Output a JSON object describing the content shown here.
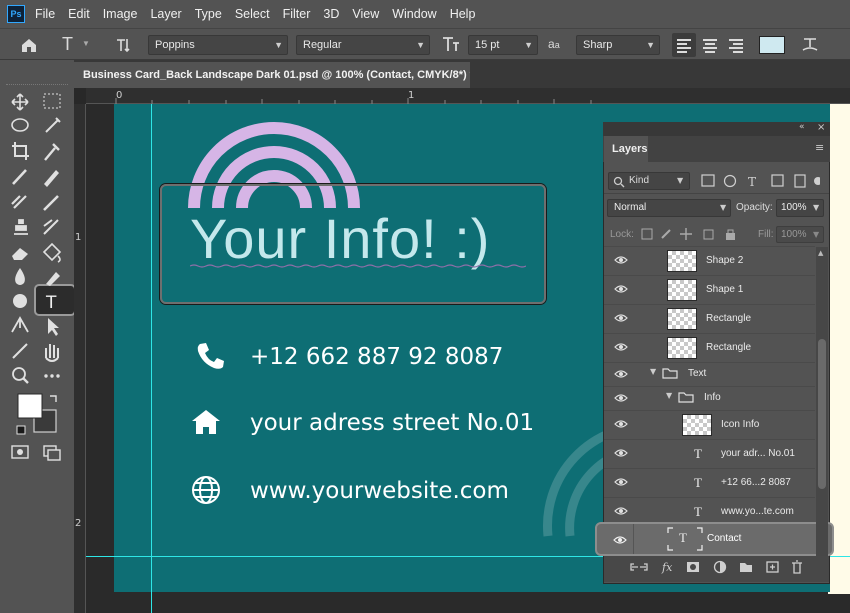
{
  "app": {
    "logo": "Ps"
  },
  "menu": [
    "File",
    "Edit",
    "Image",
    "Layer",
    "Type",
    "Select",
    "Filter",
    "3D",
    "View",
    "Window",
    "Help"
  ],
  "options": {
    "font_family": "Poppins",
    "font_style": "Regular",
    "font_size": "15 pt",
    "antialias_label": "a",
    "antialias": "Sharp",
    "text_color": "#cfe9f0"
  },
  "document": {
    "tab_title": "Business Card_Back Landscape Dark 01.psd @ 100% (Contact, CMYK/8*) *",
    "close": "×"
  },
  "rulers": {
    "top": [
      "0",
      "1"
    ],
    "left": [
      "1",
      "2"
    ]
  },
  "card": {
    "background": "#0e6e74",
    "title": "Your Info! :)",
    "phone": "+12 662 887 92 8087",
    "address": "your adress street No.01",
    "website": "www.yourwebsite.com",
    "arc_color": "#d6b5e6"
  },
  "layers": {
    "tab": "Layers",
    "filter_kind": "Kind",
    "blend_mode": "Normal",
    "opacity_label": "Opacity:",
    "opacity": "100%",
    "lock_label": "Lock:",
    "fill_label": "Fill:",
    "fill": "100%",
    "items": [
      {
        "name": "Shape 2",
        "kind": "shape"
      },
      {
        "name": "Shape 1",
        "kind": "shape"
      },
      {
        "name": "Rectangle",
        "kind": "shape"
      },
      {
        "name": "Rectangle",
        "kind": "shape"
      },
      {
        "name": "Text",
        "kind": "group"
      },
      {
        "name": "Info",
        "kind": "group"
      },
      {
        "name": "Icon Info",
        "kind": "smart"
      },
      {
        "name": "your adr... No.01",
        "kind": "text"
      },
      {
        "name": "+12 66...2 8087",
        "kind": "text"
      },
      {
        "name": "www.yo...te.com",
        "kind": "text"
      },
      {
        "name": "Contact",
        "kind": "text",
        "selected": true
      }
    ],
    "text_glyph": "T"
  }
}
